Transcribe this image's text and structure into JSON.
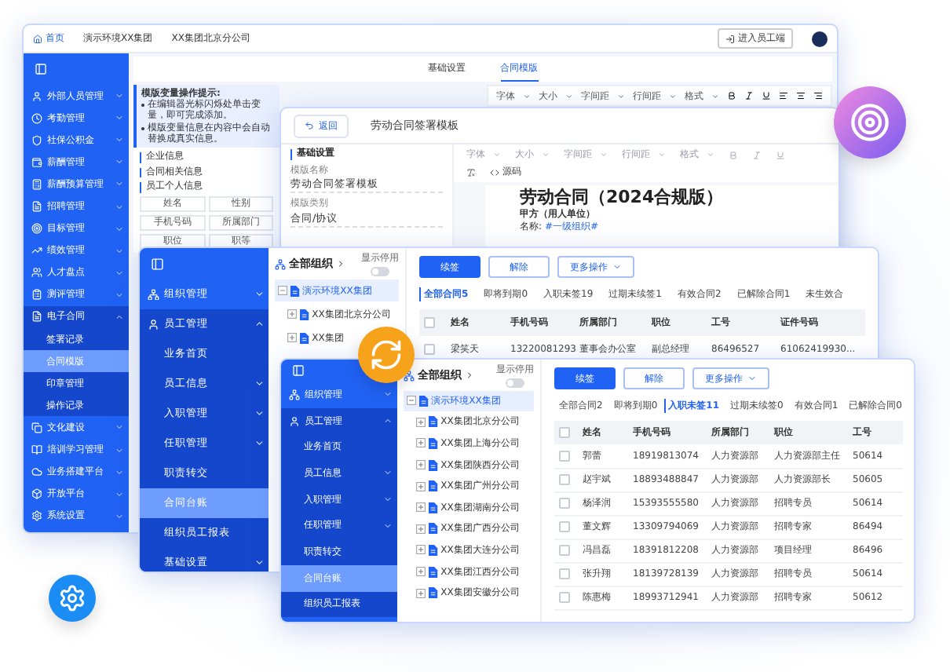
{
  "main_window": {
    "breadcrumb": [
      {
        "label": "首页",
        "selected": true
      },
      {
        "label": "演示环境XX集团",
        "selected": false
      },
      {
        "label": "XX集团北京分公司",
        "selected": false
      }
    ],
    "header_button": "进入员工端",
    "sidebar": [
      {
        "label": "外部人员管理",
        "kind": "group",
        "expanded": false,
        "selected": false
      },
      {
        "label": "考勤管理",
        "kind": "group",
        "expanded": false,
        "selected": false
      },
      {
        "label": "社保公积金",
        "kind": "group",
        "expanded": false,
        "selected": false
      },
      {
        "label": "薪酬管理",
        "kind": "group",
        "expanded": false,
        "selected": false
      },
      {
        "label": "薪酬预算管理",
        "kind": "group",
        "expanded": false,
        "selected": false
      },
      {
        "label": "招聘管理",
        "kind": "group",
        "expanded": false,
        "selected": false
      },
      {
        "label": "目标管理",
        "kind": "group",
        "expanded": false,
        "selected": false
      },
      {
        "label": "绩效管理",
        "kind": "group",
        "expanded": false,
        "selected": false
      },
      {
        "label": "人才盘点",
        "kind": "group",
        "expanded": false,
        "selected": false
      },
      {
        "label": "测评管理",
        "kind": "group",
        "expanded": false,
        "selected": false
      },
      {
        "label": "电子合同",
        "kind": "group",
        "expanded": true,
        "selected": false
      },
      {
        "label": "签署记录",
        "kind": "child",
        "selected": false
      },
      {
        "label": "合同模版",
        "kind": "child",
        "selected": true
      },
      {
        "label": "印章管理",
        "kind": "child",
        "selected": false
      },
      {
        "label": "操作记录",
        "kind": "child",
        "selected": false
      },
      {
        "label": "文化建设",
        "kind": "group",
        "expanded": false,
        "selected": false
      },
      {
        "label": "培训学习管理",
        "kind": "group",
        "expanded": false,
        "selected": false
      },
      {
        "label": "业务搭建平台",
        "kind": "group",
        "expanded": false,
        "selected": false
      },
      {
        "label": "开放平台",
        "kind": "group",
        "expanded": false,
        "selected": false
      },
      {
        "label": "系统设置",
        "kind": "group",
        "expanded": false,
        "selected": false
      }
    ],
    "tabs": [
      {
        "label": "基础设置",
        "selected": false
      },
      {
        "label": "合同模版",
        "selected": true
      }
    ],
    "hint": {
      "title": "模版变量操作提示:",
      "bullets": [
        "在编辑器光标闪烁处单击变量，即可完成添加。",
        "模版变量信息在内容中会自动替换成真实信息。"
      ]
    },
    "variable_groups": [
      {
        "title": "企业信息"
      },
      {
        "title": "合同相关信息"
      },
      {
        "title": "员工个人信息",
        "chips": [
          "姓名",
          "性别",
          "手机号码",
          "所属部门",
          "职位",
          "职等"
        ]
      }
    ],
    "toolbar": [
      "字体",
      "大小",
      "字间距",
      "行间距",
      "格式"
    ]
  },
  "template_window": {
    "back": "返回",
    "title": "劳动合同签署模板",
    "section": "基础设置",
    "fields": [
      {
        "label": "模版名称",
        "value": "劳动合同签署模板"
      },
      {
        "label": "模版类别",
        "value": "合同/协议"
      }
    ],
    "toolbar": [
      "字体",
      "大小",
      "字间距",
      "行间距",
      "格式"
    ],
    "source_button": "源码",
    "doc_title": "劳动合同（2024合规版）",
    "party": "甲方（用人单位）",
    "name_label": "名称:",
    "name_value": "#一级组织#"
  },
  "ledger_windows": [
    {
      "sidebar": [
        {
          "label": "组织管理",
          "kind": "group",
          "expanded": false,
          "selected": false
        },
        {
          "label": "员工管理",
          "kind": "group",
          "expanded": true,
          "selected": false
        },
        {
          "label": "业务首页",
          "kind": "child",
          "selected": false
        },
        {
          "label": "员工信息",
          "kind": "child",
          "expanded": false,
          "selected": false
        },
        {
          "label": "入职管理",
          "kind": "child",
          "expanded": false,
          "selected": false
        },
        {
          "label": "任职管理",
          "kind": "child",
          "expanded": false,
          "selected": false
        },
        {
          "label": "职责转交",
          "kind": "child",
          "selected": false
        },
        {
          "label": "合同台账",
          "kind": "child",
          "selected": true
        },
        {
          "label": "组织员工报表",
          "kind": "child",
          "selected": false
        },
        {
          "label": "基础设置",
          "kind": "child",
          "expanded": false,
          "selected": false
        }
      ],
      "tree": {
        "title": "全部组织",
        "toggle_label": "显示停用",
        "toggle_on": false,
        "nodes": [
          {
            "label": "演示环境XX集团",
            "expanded": true,
            "selected": true,
            "children": [
              {
                "label": "XX集团北京分公司",
                "expanded": false,
                "selected": false
              },
              {
                "label": "XX集团",
                "expanded": false,
                "selected": false
              }
            ]
          }
        ]
      },
      "actions": [
        {
          "label": "续签",
          "kind": "primary"
        },
        {
          "label": "解除",
          "kind": "outline"
        },
        {
          "label": "更多操作",
          "kind": "dropdown"
        }
      ],
      "filters": [
        {
          "label": "全部合同5",
          "selected": true
        },
        {
          "label": "即将到期0",
          "selected": false
        },
        {
          "label": "入职未签19",
          "selected": false
        },
        {
          "label": "过期未续签1",
          "selected": false
        },
        {
          "label": "有效合同2",
          "selected": false
        },
        {
          "label": "已解除合同1",
          "selected": false
        },
        {
          "label": "未生效合",
          "selected": false
        }
      ],
      "all_checked": false,
      "columns": [
        "姓名",
        "手机号码",
        "所属部门",
        "职位",
        "工号",
        "证件号码"
      ],
      "rows": [
        {
          "checked": false,
          "cells": [
            "梁笑天",
            "13220081293",
            "董事会办公室",
            "副总经理",
            "86496527",
            "61062419930..."
          ]
        }
      ]
    },
    {
      "sidebar": [
        {
          "label": "组织管理",
          "kind": "group",
          "expanded": false,
          "selected": false
        },
        {
          "label": "员工管理",
          "kind": "group",
          "expanded": true,
          "selected": false
        },
        {
          "label": "业务首页",
          "kind": "child",
          "selected": false
        },
        {
          "label": "员工信息",
          "kind": "child",
          "expanded": false,
          "selected": false
        },
        {
          "label": "入职管理",
          "kind": "child",
          "expanded": false,
          "selected": false
        },
        {
          "label": "任职管理",
          "kind": "child",
          "expanded": false,
          "selected": false
        },
        {
          "label": "职责转交",
          "kind": "child",
          "selected": false
        },
        {
          "label": "合同台账",
          "kind": "child",
          "selected": true
        },
        {
          "label": "组织员工报表",
          "kind": "child",
          "selected": false
        }
      ],
      "tree": {
        "title": "全部组织",
        "toggle_label": "显示停用",
        "toggle_on": false,
        "nodes": [
          {
            "label": "演示环境XX集团",
            "expanded": true,
            "selected": true,
            "children": [
              {
                "label": "XX集团北京分公司",
                "expanded": false,
                "selected": false
              },
              {
                "label": "XX集团上海分公司",
                "expanded": false,
                "selected": false
              },
              {
                "label": "XX集团陕西分公司",
                "expanded": false,
                "selected": false
              },
              {
                "label": "XX集团广州分公司",
                "expanded": false,
                "selected": false
              },
              {
                "label": "XX集团湖南分公司",
                "expanded": false,
                "selected": false
              },
              {
                "label": "XX集团广西分公司",
                "expanded": false,
                "selected": false
              },
              {
                "label": "XX集团大连分公司",
                "expanded": false,
                "selected": false
              },
              {
                "label": "XX集团江西分公司",
                "expanded": false,
                "selected": false
              },
              {
                "label": "XX集团安徽分公司",
                "expanded": false,
                "selected": false
              }
            ]
          }
        ]
      },
      "actions": [
        {
          "label": "续签",
          "kind": "primary"
        },
        {
          "label": "解除",
          "kind": "outline"
        },
        {
          "label": "更多操作",
          "kind": "dropdown"
        }
      ],
      "filters": [
        {
          "label": "全部合同2",
          "selected": false
        },
        {
          "label": "即将到期0",
          "selected": false
        },
        {
          "label": "入职未签11",
          "selected": true
        },
        {
          "label": "过期未续签0",
          "selected": false
        },
        {
          "label": "有效合同1",
          "selected": false
        },
        {
          "label": "已解除合同0",
          "selected": false
        }
      ],
      "all_checked": false,
      "columns": [
        "姓名",
        "手机号码",
        "所属部门",
        "职位",
        "工号"
      ],
      "rows": [
        {
          "checked": false,
          "cells": [
            "郭蕾",
            "18919813074",
            "人力资源部",
            "人力资源部主任",
            "50614"
          ]
        },
        {
          "checked": false,
          "cells": [
            "赵宇斌",
            "18893488847",
            "人力资源部",
            "人力资源部长",
            "50605"
          ]
        },
        {
          "checked": false,
          "cells": [
            "杨泽润",
            "15393555580",
            "人力资源部",
            "招聘专员",
            "50614"
          ]
        },
        {
          "checked": false,
          "cells": [
            "董文辉",
            "13309794069",
            "人力资源部",
            "招聘专家",
            "86494"
          ]
        },
        {
          "checked": false,
          "cells": [
            "冯昌磊",
            "18391812208",
            "人力资源部",
            "项目经理",
            "86496"
          ]
        },
        {
          "checked": false,
          "cells": [
            "张升翔",
            "18139728139",
            "人力资源部",
            "招聘专员",
            "50614"
          ]
        },
        {
          "checked": false,
          "cells": [
            "陈惠梅",
            "18993712941",
            "人力资源部",
            "招聘专家",
            "50612"
          ]
        }
      ]
    }
  ]
}
